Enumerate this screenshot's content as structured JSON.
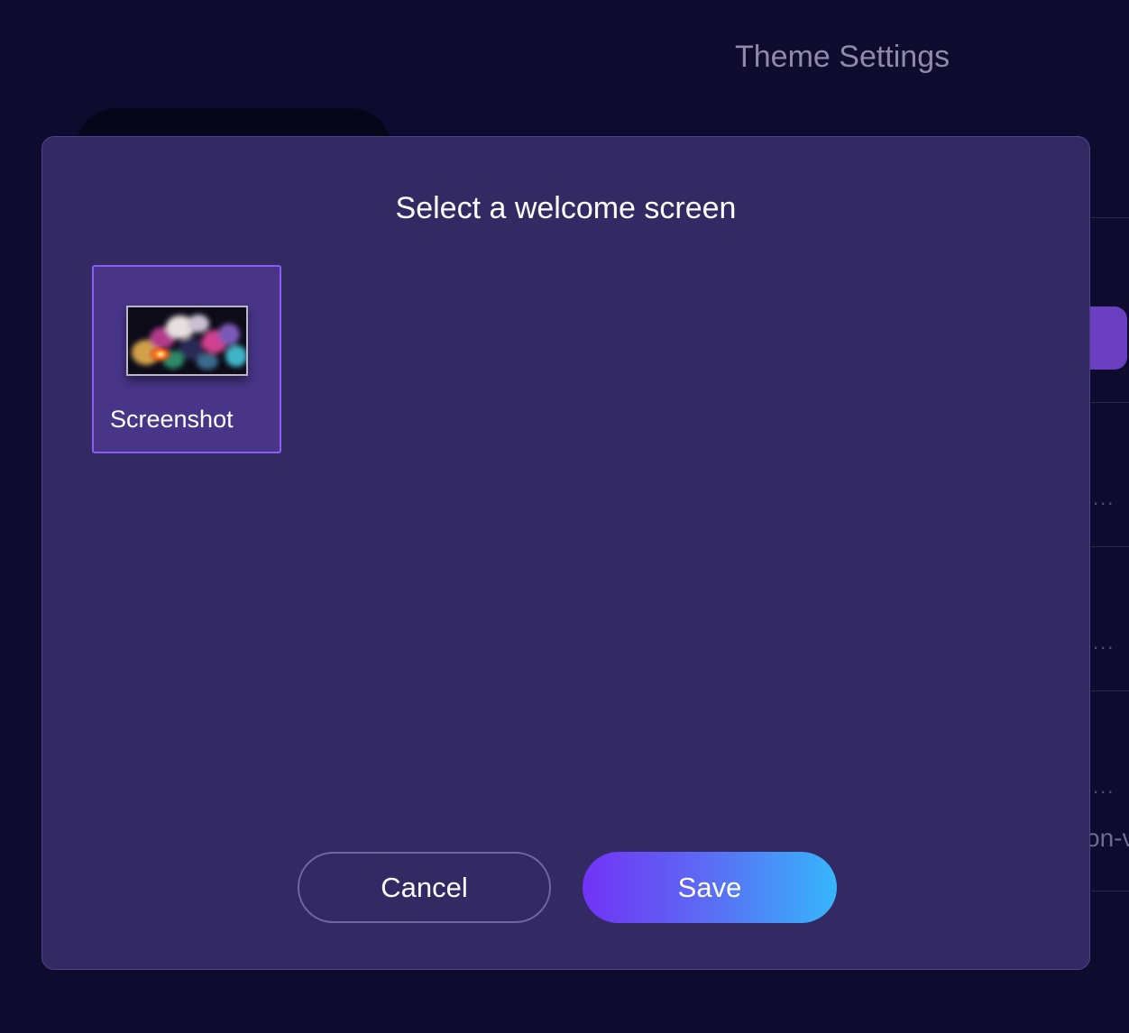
{
  "background": {
    "page_title": "Theme Settings",
    "truncated_text": "on-v",
    "ellipsis": "..."
  },
  "modal": {
    "title": "Select a welcome screen",
    "screens": [
      {
        "label": "Screenshot",
        "selected": true,
        "thumbnail_icon": "nebula-image"
      }
    ],
    "cancel_label": "Cancel",
    "save_label": "Save"
  },
  "colors": {
    "page_bg": "#0f0b2e",
    "modal_bg": "#332a64",
    "selected_card_bg": "#483588",
    "selected_border": "#8b5cf6",
    "save_gradient_start": "#7133f5",
    "save_gradient_end": "#36b6fb"
  }
}
